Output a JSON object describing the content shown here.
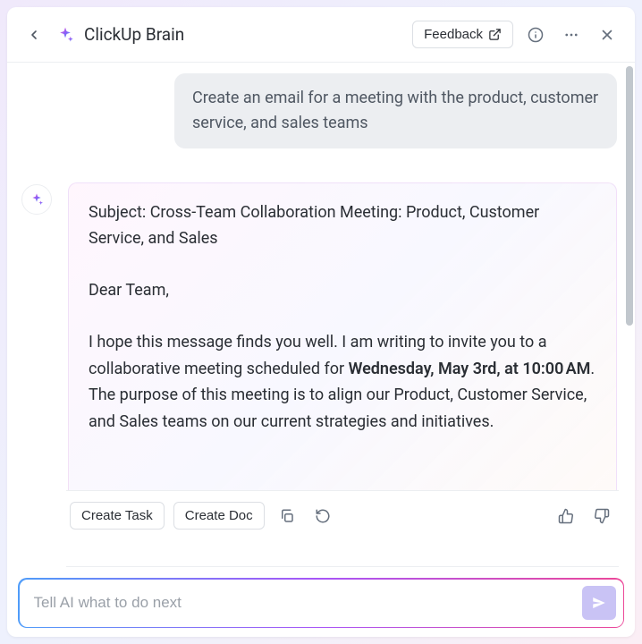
{
  "header": {
    "title": "ClickUp Brain",
    "feedback_label": "Feedback"
  },
  "conversation": {
    "user_message": "Create an email for a meeting with the product, customer service, and sales teams",
    "ai_response": {
      "subject": "Subject: Cross-Team Collaboration Meeting: Product, Customer Service, and Sales",
      "greeting": "Dear Team,",
      "body_before_bold": "I hope this message finds you well. I am writing to invite you to a collaborative meeting scheduled for ",
      "bold_datetime": "Wednesday, May 3rd, at 10:00 AM",
      "body_after_bold": ". The purpose of this meeting is to align our Product, Customer Service, and Sales teams on our current strategies and initiatives."
    }
  },
  "actions": {
    "create_task": "Create Task",
    "create_doc": "Create Doc"
  },
  "input": {
    "placeholder": "Tell AI what to do next"
  },
  "icons": {
    "back": "back-icon",
    "sparkle": "sparkle-icon",
    "external": "external-link-icon",
    "info": "info-icon",
    "more": "more-icon",
    "close": "close-icon",
    "copy": "copy-icon",
    "regenerate": "regenerate-icon",
    "thumbs_up": "thumbs-up-icon",
    "thumbs_down": "thumbs-down-icon",
    "send": "send-icon"
  }
}
